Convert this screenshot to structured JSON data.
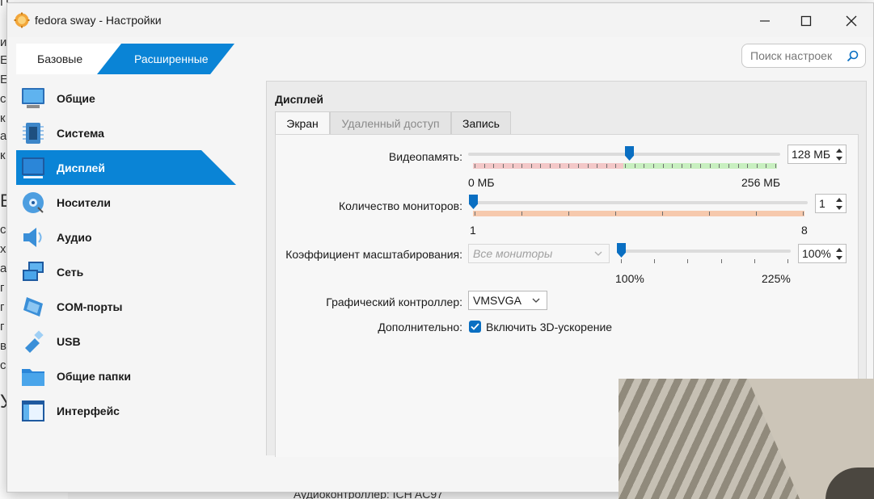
{
  "window": {
    "title": "fedora sway - Настройки",
    "icons": {
      "app": "gear-sun-icon",
      "minimize": "minimize-icon",
      "maximize": "maximize-icon",
      "close": "close-icon"
    }
  },
  "modes": {
    "basic": "Базовые",
    "advanced": "Расширенные",
    "active": "advanced"
  },
  "search": {
    "placeholder": "Поиск настроек",
    "icon": "search-icon"
  },
  "sidebar": {
    "items": [
      {
        "label": "Общие",
        "icon": "monitor-general-icon"
      },
      {
        "label": "Система",
        "icon": "chip-icon"
      },
      {
        "label": "Дисплей",
        "icon": "display-icon",
        "active": true
      },
      {
        "label": "Носители",
        "icon": "disk-icon"
      },
      {
        "label": "Аудио",
        "icon": "speaker-icon"
      },
      {
        "label": "Сеть",
        "icon": "network-icon"
      },
      {
        "label": "COM-порты",
        "icon": "serial-port-icon"
      },
      {
        "label": "USB",
        "icon": "usb-icon"
      },
      {
        "label": "Общие папки",
        "icon": "folder-icon"
      },
      {
        "label": "Интерфейс",
        "icon": "window-interface-icon"
      }
    ]
  },
  "panel": {
    "title": "Дисплей",
    "tabs": [
      {
        "label": "Экран",
        "state": "active"
      },
      {
        "label": "Удаленный доступ",
        "state": "disabled"
      },
      {
        "label": "Запись",
        "state": "normal"
      }
    ],
    "video_memory": {
      "label": "Видеопамять:",
      "value": "128 МБ",
      "min_label": "0 МБ",
      "max_label": "256 МБ",
      "fraction": 0.5
    },
    "monitors": {
      "label": "Количество мониторов:",
      "value": "1",
      "min_label": "1",
      "max_label": "8",
      "fraction": 0.0
    },
    "scale": {
      "label": "Коэффициент масштабирования:",
      "combo": "Все мониторы",
      "value": "100%",
      "min_label": "100%",
      "max_label": "225%",
      "fraction": 0.0
    },
    "controller": {
      "label": "Графический контроллер:",
      "value": "VMSVGA"
    },
    "extra": {
      "label": "Дополнительно:",
      "checkbox_label": "Включить 3D-ускорение",
      "checked": true
    }
  },
  "background": {
    "bottom_text": "Аудиоконтроллер:   ICH AC97"
  },
  "colors": {
    "accent": "#0a84d6",
    "handle": "#0a6fc2",
    "mem_red": "#f3c8c8",
    "mem_green": "#c8efc0",
    "monitor_bar": "#f6c9ad"
  }
}
